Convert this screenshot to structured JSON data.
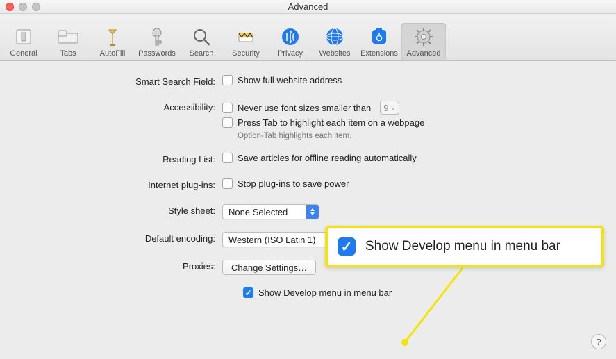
{
  "window": {
    "title": "Advanced"
  },
  "toolbar": {
    "items": [
      {
        "label": "General"
      },
      {
        "label": "Tabs"
      },
      {
        "label": "AutoFill"
      },
      {
        "label": "Passwords"
      },
      {
        "label": "Search"
      },
      {
        "label": "Security"
      },
      {
        "label": "Privacy"
      },
      {
        "label": "Websites"
      },
      {
        "label": "Extensions"
      },
      {
        "label": "Advanced"
      }
    ]
  },
  "settings": {
    "smart_search": {
      "label": "Smart Search Field:",
      "show_full_address": "Show full website address"
    },
    "accessibility": {
      "label": "Accessibility:",
      "never_use_small": "Never use font sizes smaller than",
      "font_size": "9",
      "press_tab": "Press Tab to highlight each item on a webpage",
      "hint": "Option-Tab highlights each item."
    },
    "reading_list": {
      "label": "Reading List:",
      "save_offline": "Save articles for offline reading automatically"
    },
    "plugins": {
      "label": "Internet plug-ins:",
      "stop_to_save": "Stop plug-ins to save power"
    },
    "style_sheet": {
      "label": "Style sheet:",
      "value": "None Selected"
    },
    "default_encoding": {
      "label": "Default encoding:",
      "value": "Western (ISO Latin 1)"
    },
    "proxies": {
      "label": "Proxies:",
      "button": "Change Settings…"
    },
    "develop_menu": {
      "label": "Show Develop menu in menu bar"
    }
  },
  "callout": {
    "text": "Show Develop menu in menu bar"
  },
  "help": {
    "glyph": "?"
  }
}
